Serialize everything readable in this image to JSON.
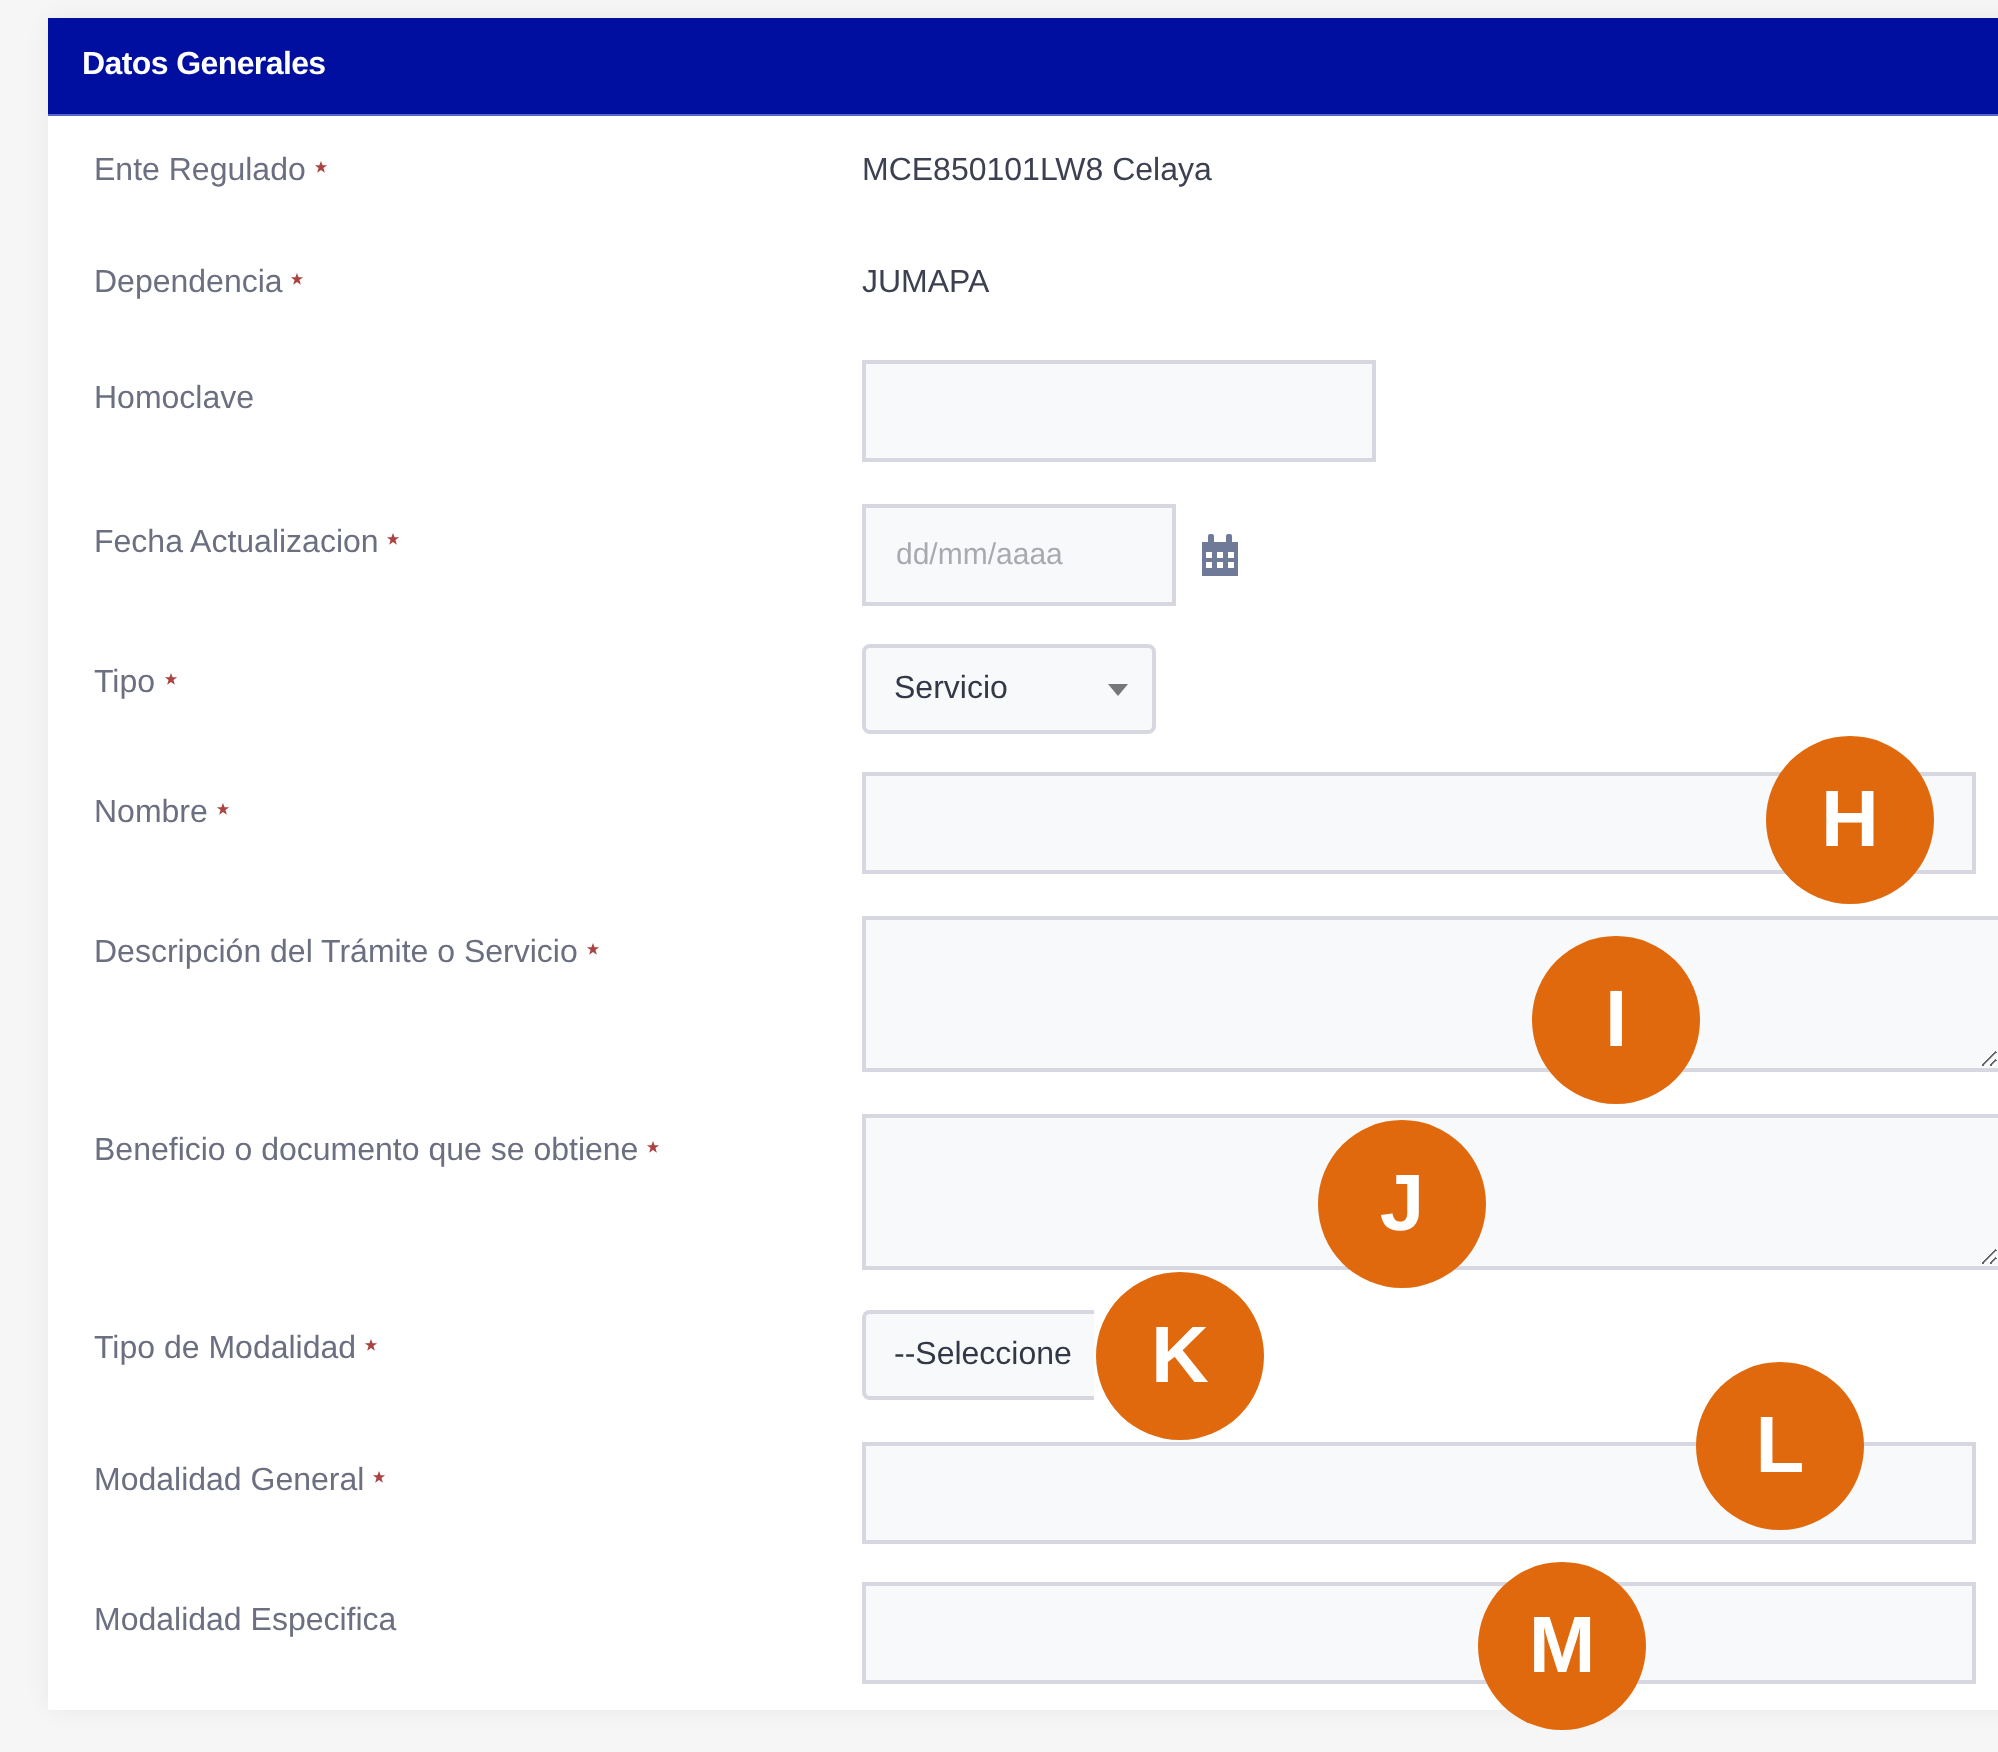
{
  "panel": {
    "title": "Datos Generales"
  },
  "fields": [
    {
      "label": "Ente Regulado",
      "required": true,
      "kind": "text",
      "value": "MCE850101LW8 Celaya"
    },
    {
      "label": "Dependencia",
      "required": true,
      "kind": "text",
      "value": "JUMAPA"
    },
    {
      "label": "Homoclave",
      "required": false,
      "kind": "shortinput"
    },
    {
      "label": "Fecha Actualizacion",
      "required": true,
      "kind": "date",
      "placeholder": "dd/mm/aaaa"
    },
    {
      "label": "Tipo",
      "required": true,
      "kind": "select",
      "value": "Servicio"
    },
    {
      "label": "Nombre",
      "required": true,
      "kind": "input"
    },
    {
      "label": "Descripción del Trámite o Servicio",
      "required": true,
      "kind": "textarea"
    },
    {
      "label": "Beneficio o documento que se obtiene",
      "required": true,
      "kind": "textarea"
    },
    {
      "label": "Tipo de Modalidad",
      "required": true,
      "kind": "select",
      "value": "--Seleccione"
    },
    {
      "label": "Modalidad General",
      "required": true,
      "kind": "input"
    },
    {
      "label": "Modalidad Especifica",
      "required": false,
      "kind": "input"
    }
  ],
  "markers": [
    {
      "letter": "H"
    },
    {
      "letter": "I"
    },
    {
      "letter": "J"
    },
    {
      "letter": "K"
    },
    {
      "letter": "L"
    },
    {
      "letter": "M"
    }
  ]
}
